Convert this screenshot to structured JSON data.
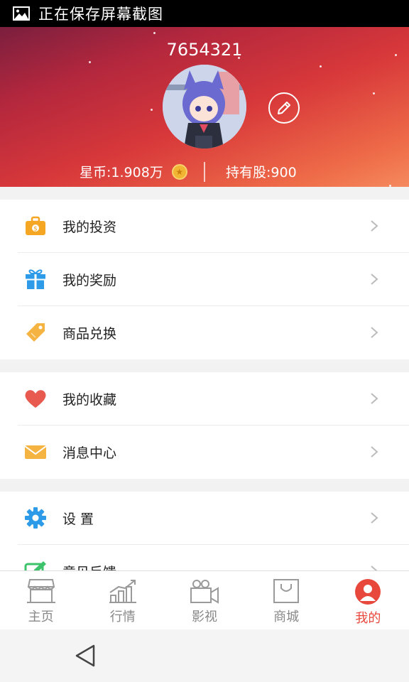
{
  "status_bar": {
    "text": "正在保存屏幕截图",
    "icon": "image-icon"
  },
  "profile": {
    "username": "7654321",
    "coins_label": "星币:1.908万",
    "shares_label": "持有股:900"
  },
  "menu_groups": [
    [
      {
        "label": "我的投资",
        "icon": "briefcase-icon",
        "color": "#f5a623"
      },
      {
        "label": "我的奖励",
        "icon": "gift-icon",
        "color": "#2e9be8"
      },
      {
        "label": "商品兑换",
        "icon": "tag-icon",
        "color": "#f5b342"
      }
    ],
    [
      {
        "label": "我的收藏",
        "icon": "heart-icon",
        "color": "#e85a4f"
      },
      {
        "label": "消息中心",
        "icon": "envelope-icon",
        "color": "#f5b342"
      }
    ],
    [
      {
        "label": "设 置",
        "icon": "gear-icon",
        "color": "#2e9be8"
      },
      {
        "label": "意见反馈",
        "icon": "feedback-icon",
        "color": "#3cc36b"
      }
    ]
  ],
  "bottom_nav": [
    {
      "label": "主页",
      "icon": "storefront-icon",
      "active": false
    },
    {
      "label": "行情",
      "icon": "trend-chart-icon",
      "active": false
    },
    {
      "label": "影视",
      "icon": "video-camera-icon",
      "active": false
    },
    {
      "label": "商城",
      "icon": "shopping-bag-icon",
      "active": false
    },
    {
      "label": "我的",
      "icon": "profile-icon",
      "active": true
    }
  ],
  "colors": {
    "accent": "#e8483c",
    "header_start": "#7a1f3e",
    "header_end": "#f58a5e"
  }
}
